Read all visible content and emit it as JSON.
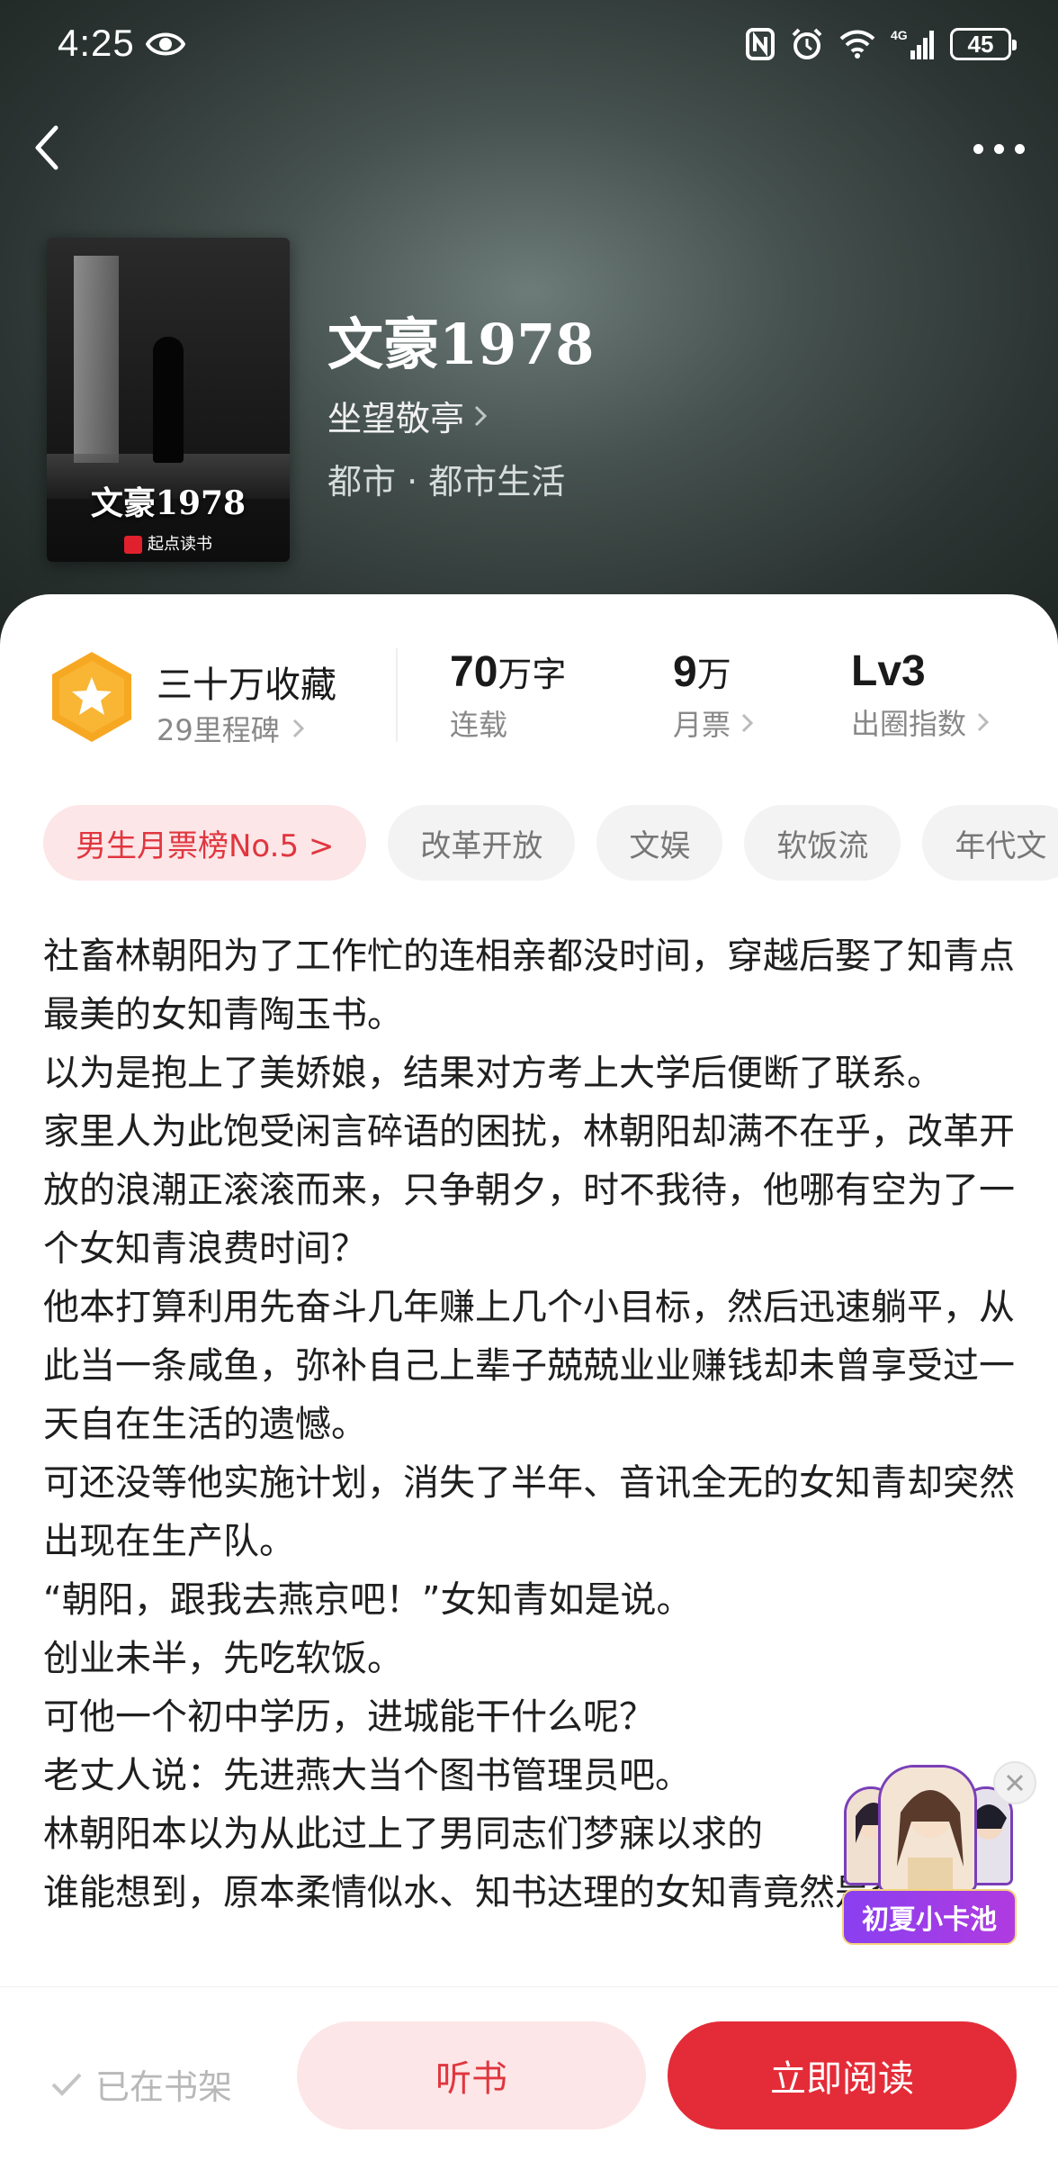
{
  "status_bar": {
    "time": "4:25",
    "battery": "45"
  },
  "book": {
    "title": "文豪1978",
    "cover_title": "文豪1978",
    "cover_publisher": "起点读书",
    "author": "坐望敬亭",
    "genre": "都市 · 都市生活"
  },
  "stats": {
    "collect_title": "三十万收藏",
    "collect_sub": "29里程碑",
    "words_value": "70",
    "words_unit": "万字",
    "words_label": "连载",
    "tickets_value": "9",
    "tickets_unit": "万",
    "tickets_label": "月票",
    "level_value": "Lv3",
    "level_label": "出圈指数"
  },
  "tags": [
    "男生月票榜No.5 >",
    "改革开放",
    "文娱",
    "软饭流",
    "年代文"
  ],
  "synopsis": [
    "社畜林朝阳为了工作忙的连相亲都没时间，穿越后娶了知青点最美的女知青陶玉书。",
    "以为是抱上了美娇娘，结果对方考上大学后便断了联系。",
    "家里人为此饱受闲言碎语的困扰，林朝阳却满不在乎，改革开放的浪潮正滚滚而来，只争朝夕，时不我待，他哪有空为了一个女知青浪费时间？",
    "他本打算利用先奋斗几年赚上几个小目标，然后迅速躺平，从此当一条咸鱼，弥补自己上辈子兢兢业业赚钱却未曾享受过一天自在生活的遗憾。",
    "可还没等他实施计划，消失了半年、音讯全无的女知青却突然出现在生产队。",
    "“朝阳，跟我去燕京吧！”女知青如是说。",
    "创业未半，先吃软饭。",
    "可他一个初中学历，进城能干什么呢？",
    "老丈人说：先进燕大当个图书管理员吧。",
    "林朝阳本以为从此过上了男同志们梦寐以求的",
    "谁能想到，原本柔情似水、知书达理的女知青竟然是个"
  ],
  "float_card": {
    "label": "初夏小卡池"
  },
  "bottom_bar": {
    "shelf_label": "已在书架",
    "listen_label": "听书",
    "read_label": "立即阅读"
  },
  "colors": {
    "accent": "#e42c38",
    "accent_soft": "#fde6e7",
    "badge": "#f7a823"
  }
}
